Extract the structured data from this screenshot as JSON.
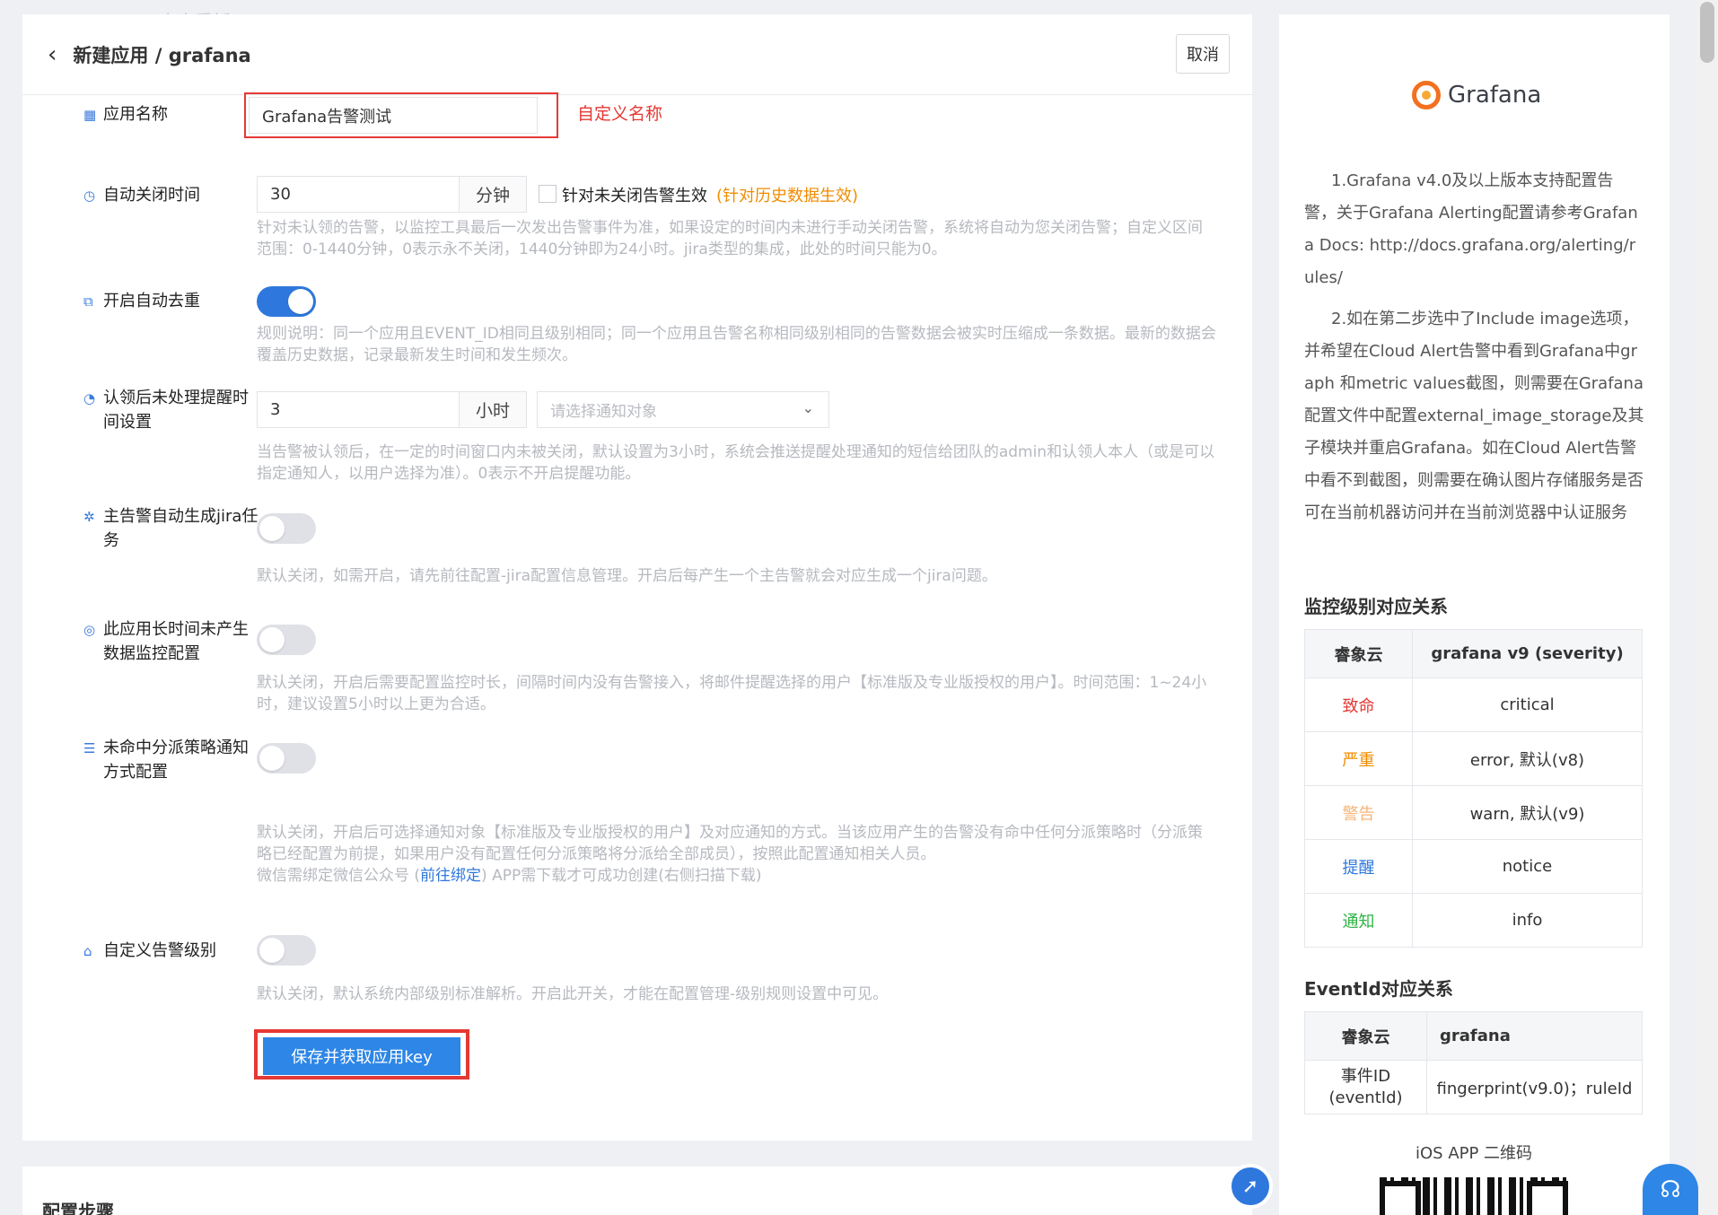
{
  "ghost_nav": {
    "label": "个人看板"
  },
  "header": {
    "back_icon": "chevron-left-icon",
    "title": "新建应用 / grafana",
    "cancel_label": "取消"
  },
  "form": {
    "app_name": {
      "label": "应用名称",
      "value": "Grafana告警测试",
      "annotation": "自定义名称"
    },
    "auto_close": {
      "label": "自动关闭时间",
      "value": "30",
      "unit": "分钟",
      "checkbox_label": "针对未关闭告警生效",
      "checkbox_note": "(针对历史数据生效)",
      "desc": "针对未认领的告警，以监控工具最后一次发出告警事件为准，如果设定的时间内未进行手动关闭告警，系统将自动为您关闭告警；自定义区间范围：0-1440分钟，0表示永不关闭，1440分钟即为24小时。jira类型的集成，此处的时间只能为0。"
    },
    "dedup": {
      "label": "开启自动去重",
      "enabled": true,
      "desc": "规则说明：同一个应用且EVENT_ID相同且级别相同；同一个应用且告警名称相同级别相同的告警数据会被实时压缩成一条数据。最新的数据会覆盖历史数据，记录最新发生时间和发生频次。"
    },
    "reminder": {
      "label": "认领后未处理提醒时间设置",
      "value": "3",
      "unit": "小时",
      "select_placeholder": "请选择通知对象",
      "desc": "当告警被认领后，在一定的时间窗口内未被关闭，默认设置为3小时，系统会推送提醒处理通知的短信给团队的admin和认领人本人（或是可以指定通知人，以用户选择为准）。0表示不开启提醒功能。"
    },
    "jira": {
      "label": "主告警自动生成jira任务",
      "enabled": false,
      "desc": "默认关闭，如需开启，请先前往配置-jira配置信息管理。开启后每产生一个主告警就会对应生成一个jira问题。"
    },
    "no_data": {
      "label": "此应用长时间未产生数据监控配置",
      "enabled": false,
      "desc": "默认关闭，开启后需要配置监控时长，间隔时间内没有告警接入，将邮件提醒选择的用户【标准版及专业版授权的用户】。时间范围：1~24小时，建议设置5小时以上更为合适。"
    },
    "unmatched": {
      "label": "未命中分派策略通知方式配置",
      "enabled": false,
      "desc1": "默认关闭，开启后可选择通知对象【标准版及专业版授权的用户】及对应通知的方式。当该应用产生的告警没有命中任何分派策略时（分派策略已经配置为前提，如果用户没有配置任何分派策略将分派给全部成员），按照此配置通知相关人员。",
      "desc2_prefix": "微信需绑定微信公众号 (",
      "desc2_link": "前往绑定",
      "desc2_suffix": ") APP需下载才可成功创建(右侧扫描下载)"
    },
    "custom_level": {
      "label": "自定义告警级别",
      "enabled": false,
      "desc": "默认关闭，默认系统内部级别标准解析。开启此开关，才能在配置管理-级别规则设置中可见。"
    },
    "submit_label": "保存并获取应用key"
  },
  "steps": {
    "title": "配置步骤"
  },
  "sidebar": {
    "logo_text": "Grafana",
    "para1": "1.Grafana v4.0及以上版本支持配置告警，关于Grafana Alerting配置请参考Grafana Docs: http://docs.grafana.org/alerting/rules/",
    "para2": "2.如在第二步选中了Include image选项，并希望在Cloud Alert告警中看到Grafana中graph 和metric values截图，则需要在Grafana配置文件中配置external_image_storage及其子模块并重启Grafana。如在Cloud Alert告警中看不到截图，则需要在确认图片存储服务是否可在当前机器访问并在当前浏览器中认证服务",
    "severity_title": "监控级别对应关系",
    "severity_headers": [
      "睿象云",
      "grafana v9 (severity)"
    ],
    "severity_rows": [
      {
        "level": "致命",
        "value": "critical",
        "color": "#e53935"
      },
      {
        "level": "严重",
        "value": "error, 默认(v8)",
        "color": "#f08c00"
      },
      {
        "level": "警告",
        "value": "warn, 默认(v9)",
        "color": "#f5b57a"
      },
      {
        "level": "提醒",
        "value": "notice",
        "color": "#2e78dd"
      },
      {
        "level": "通知",
        "value": "info",
        "color": "#2fb344"
      }
    ],
    "event_title": "EventId对应关系",
    "event_headers": [
      "睿象云",
      "grafana"
    ],
    "event_row": {
      "left": "事件ID (eventId)",
      "right": "fingerprint(v9.0)；ruleId"
    },
    "ios_label": "iOS APP 二维码"
  }
}
